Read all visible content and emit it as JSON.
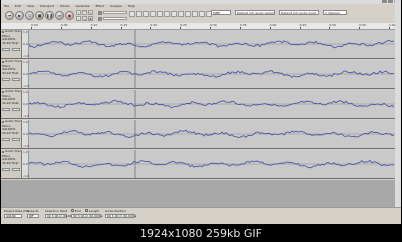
{
  "window": {
    "title": "Audio"
  },
  "menu": [
    "File",
    "Edit",
    "View",
    "Transport",
    "Tracks",
    "Generate",
    "Effect",
    "Analyze",
    "Help"
  ],
  "transport": [
    {
      "icon": "skip-start-icon",
      "glyph": "⏮"
    },
    {
      "icon": "play-icon",
      "glyph": "▶"
    },
    {
      "icon": "loop-icon",
      "glyph": "↻"
    },
    {
      "icon": "stop-icon",
      "glyph": "■"
    },
    {
      "icon": "pause-icon",
      "glyph": "❚❚"
    },
    {
      "icon": "skip-end-icon",
      "glyph": "⏭"
    },
    {
      "icon": "record-icon",
      "glyph": "●"
    }
  ],
  "devices": {
    "host": "MME",
    "output": "Default 2ch audio output",
    "input": "Default 2ch audio input",
    "channels": "2 (Stereo)"
  },
  "ruler": {
    "ticks": [
      "0:00",
      "0:05",
      "0:10",
      "0:15",
      "0:20",
      "0:25",
      "0:30",
      "0:35",
      "0:40",
      "0:45",
      "0:50",
      "0:55",
      "1:00"
    ]
  },
  "tracks": [
    {
      "name": "Audio Track",
      "meta": "Mono, 44100Hz\n32-bit float",
      "mute": "Mute",
      "solo": "Solo",
      "scale": [
        "1.0",
        "0.0",
        "-1.0"
      ]
    },
    {
      "name": "Audio Track",
      "meta": "Mono, 44100Hz\n32-bit float",
      "mute": "Mute",
      "solo": "Solo",
      "scale": [
        "1.0",
        "0.0",
        "-1.0"
      ]
    },
    {
      "name": "Audio Track",
      "meta": "Mono, 44100Hz\n32-bit float",
      "mute": "Mute",
      "solo": "Solo",
      "scale": [
        "1.0",
        "0.0",
        "-1.0"
      ]
    },
    {
      "name": "Audio Track",
      "meta": "Mono, 44100Hz\n32-bit float",
      "mute": "Mute",
      "solo": "Solo",
      "scale": [
        "1.0",
        "0.0",
        "-1.0"
      ]
    },
    {
      "name": "Audio Track",
      "meta": "Mono, 44100Hz\n32-bit float",
      "mute": "Mute",
      "solo": "Solo",
      "scale": [
        "1.0",
        "0.0",
        "-1.0"
      ]
    }
  ],
  "status": {
    "rate_label": "Project Rate (Hz)",
    "rate_value": "44100",
    "snap_label": "Snap-To",
    "snap_value": "Off",
    "start_label": "Selection Start",
    "end_label": "End",
    "length_label": "Length",
    "pos_label": "Audio Position",
    "time_zero": "00 h 00 m 00.000 s"
  },
  "caption": "1924x1080 259kb GIF",
  "colors": {
    "wave": "#3f4aa8",
    "wave_bg": "#c9c9c9",
    "page_bg": "#000000"
  }
}
